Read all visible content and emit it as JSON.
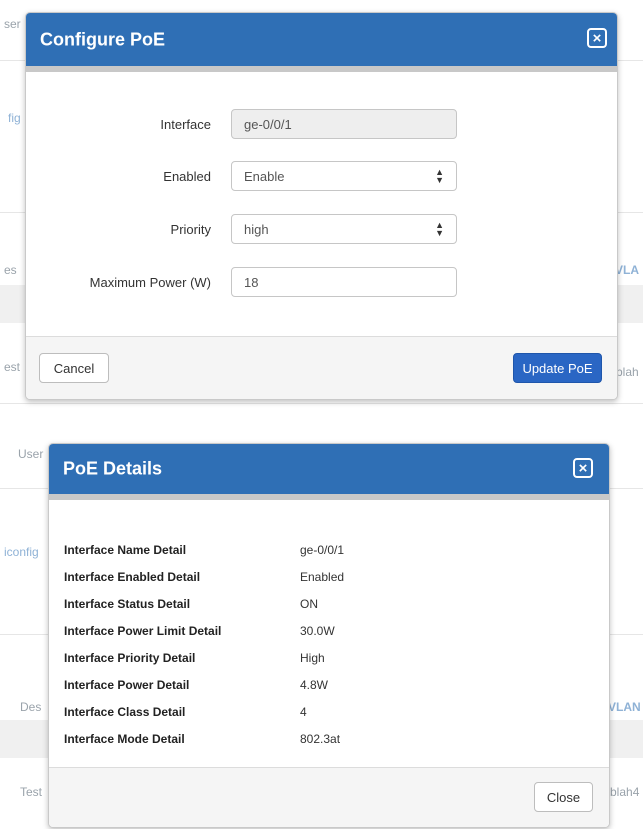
{
  "background": {
    "top": {
      "user_fragment": "ser",
      "config_fragment": "fig",
      "desc_fragment": "es",
      "vlan_fragment": "VLA",
      "test_fragment": "est",
      "blah_fragment": "blah"
    },
    "bottom": {
      "user_fragment": "User",
      "config_fragment": "iconfig",
      "desc_fragment": "Des",
      "vlan_fragment": "VLAN",
      "test_fragment": "Test",
      "blah_fragment": "blah4"
    }
  },
  "configure_modal": {
    "title": "Configure PoE",
    "close_glyph": "×",
    "fields": {
      "interface_label": "Interface",
      "interface_value": "ge-0/0/1",
      "enabled_label": "Enabled",
      "enabled_value": "Enable",
      "priority_label": "Priority",
      "priority_value": "high",
      "max_power_label": "Maximum Power (W)",
      "max_power_value": "18"
    },
    "cancel_label": "Cancel",
    "update_label": "Update PoE"
  },
  "details_modal": {
    "title": "PoE Details",
    "close_glyph": "×",
    "rows": [
      {
        "key": "Interface Name Detail",
        "value": "ge-0/0/1"
      },
      {
        "key": "Interface Enabled Detail",
        "value": "Enabled"
      },
      {
        "key": "Interface Status Detail",
        "value": "ON"
      },
      {
        "key": "Interface Power Limit Detail",
        "value": "30.0W"
      },
      {
        "key": "Interface Priority Detail",
        "value": "High"
      },
      {
        "key": "Interface Power Detail",
        "value": "4.8W"
      },
      {
        "key": "Interface Class Detail",
        "value": "4"
      },
      {
        "key": "Interface Mode Detail",
        "value": "802.3at"
      }
    ],
    "close_label": "Close"
  },
  "colors": {
    "header_blue": "#2f6fb5",
    "primary_button": "#2a66c4"
  }
}
